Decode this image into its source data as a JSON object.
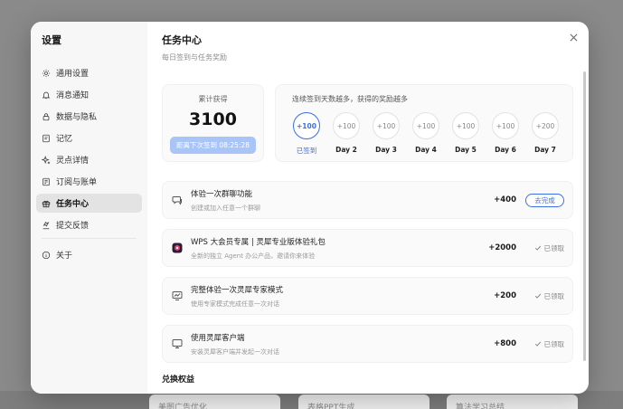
{
  "background": {
    "cards": [
      "美图广告优化",
      "表格PPT生成",
      "算法学习总结"
    ]
  },
  "sidebar": {
    "title": "设置",
    "items": [
      {
        "label": "通用设置",
        "icon": "gear-icon"
      },
      {
        "label": "消息通知",
        "icon": "bell-icon"
      },
      {
        "label": "数据与隐私",
        "icon": "lock-icon"
      },
      {
        "label": "记忆",
        "icon": "memory-icon"
      },
      {
        "label": "灵点详情",
        "icon": "sparkle-icon"
      },
      {
        "label": "订阅与账单",
        "icon": "receipt-icon"
      },
      {
        "label": "任务中心",
        "icon": "gift-icon",
        "active": true
      },
      {
        "label": "提交反馈",
        "icon": "feedback-icon"
      }
    ],
    "about": {
      "label": "关于",
      "icon": "info-icon"
    }
  },
  "header": {
    "title": "任务中心",
    "subtitle": "每日签到与任务奖励"
  },
  "total": {
    "label": "累计获得",
    "value": "3100",
    "countdown": "距离下次签到 08:25:28"
  },
  "streak": {
    "title": "连续签到天数越多，获得的奖励越多",
    "days": [
      {
        "reward": "+100",
        "label": "已签到",
        "checked": true
      },
      {
        "reward": "+100",
        "label": "Day 2"
      },
      {
        "reward": "+100",
        "label": "Day 3"
      },
      {
        "reward": "+100",
        "label": "Day 4"
      },
      {
        "reward": "+100",
        "label": "Day 5"
      },
      {
        "reward": "+100",
        "label": "Day 6"
      },
      {
        "reward": "+200",
        "label": "Day 7"
      }
    ]
  },
  "tasks": [
    {
      "title": "体验一次群聊功能",
      "desc": "创建或加入任意一个群聊",
      "reward": "+400",
      "action": "去完成",
      "done": false,
      "icon": "chat-bubble-icon"
    },
    {
      "title": "WPS 大会员专属 | 灵犀专业版体验礼包",
      "desc": "全新的独立 Agent 办公产品，邀请你来体验",
      "reward": "+2000",
      "action": "已领取",
      "done": true,
      "icon": "wps-logo-icon"
    },
    {
      "title": "完整体验一次灵犀专家模式",
      "desc": "使用专家模式完成任意一次对话",
      "reward": "+200",
      "action": "已领取",
      "done": true,
      "icon": "chart-screen-icon"
    },
    {
      "title": "使用灵犀客户端",
      "desc": "安装灵犀客户端并发起一次对话",
      "reward": "+800",
      "action": "已领取",
      "done": true,
      "icon": "monitor-icon"
    }
  ],
  "section": {
    "title": "兑换权益"
  },
  "colors": {
    "accent": "#3a70e0",
    "countdown_bg": "#a9c4f6"
  }
}
